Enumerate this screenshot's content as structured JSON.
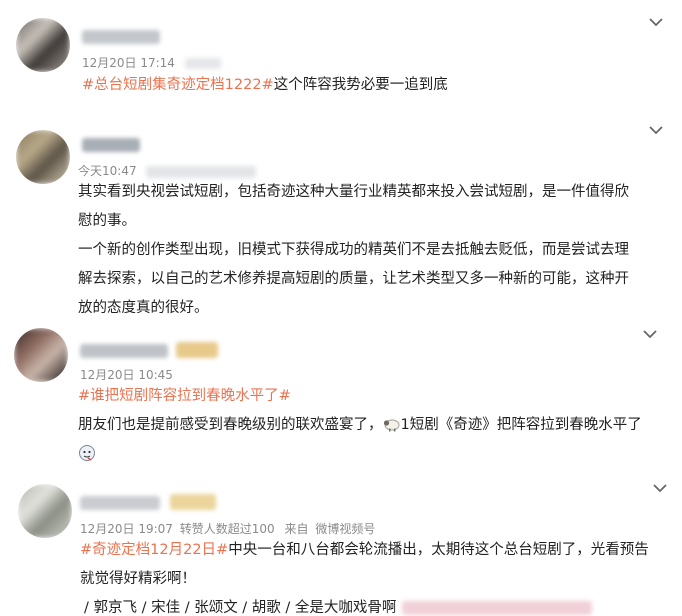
{
  "posts": [
    {
      "time": "12月20日 17:14",
      "topic": "#总台短剧集奇迹定档1222#",
      "text": "这个阵容我势必要一追到底",
      "avatar_colors": [
        "#6b6662",
        "#c9c2bb",
        "#3d3936",
        "#a49c95"
      ],
      "name_color": "#9aa0a8"
    },
    {
      "time": "今天10:47",
      "para1": "其实看到央视尝试短剧，包括奇迹这种大量行业精英都来投入尝试短剧，是一件值得欣慰的事。",
      "para1_line1": "其实看到央视尝试短剧，包括奇迹这种大量行业精英都来投入尝试短剧，是一件值得欣",
      "para1_line2": "慰的事。",
      "para2_line1": "一个新的创作类型出现，旧模式下获得成功的精英们不是去抵触去贬低，而是尝试去理",
      "para2_line2": "解去探索，以自己的艺术修养提高短剧的质量，让艺术类型又多一种新的可能，这种开",
      "para2_line3": "放的态度真的很好。",
      "avatar_colors": [
        "#8a7a5e",
        "#b8a98a",
        "#5c5346",
        "#d8ccb4"
      ],
      "name_color": "#6d7580"
    },
    {
      "time": "12月20日 10:45",
      "topic": "#谁把短剧阵容拉到春晚水平了#",
      "text_before": "朋友们也是提前感受到春晚级别的联欢盛宴了，",
      "emoji_sheep": "sheep-emoji",
      "text_after": "1短剧《奇迹》把阵容拉到春晚水平了",
      "emoji_end": "doge-emoji",
      "avatar_colors": [
        "#3b2a28",
        "#8f6d62",
        "#c9b5aa",
        "#1e1716"
      ],
      "name_color": "#7d8189"
    },
    {
      "time": "12月20日 19:07",
      "reposts": "转赞人数超过100",
      "source_prefix": "来自",
      "source": "微博视频号",
      "topic": "#奇迹定档12月22日#",
      "text_line1": "中央一台和八台都会轮流播出，太期待这个总台短剧了，光看预告",
      "text_line2": "就觉得好精彩啊！",
      "cast_line": "/ 郭京飞 / 宋佳 / 张颂文 / 胡歌 / 全是大咖戏骨啊",
      "avatar_colors": [
        "#b7b9b0",
        "#e1e2dc",
        "#8a8e84",
        "#d0d2ca"
      ],
      "name_color": "#9da2a9"
    }
  ],
  "icons": {
    "more": "chevron-down-icon"
  },
  "colors": {
    "topic": "#eb7350",
    "meta": "#8a8a8a",
    "text": "#222222"
  }
}
